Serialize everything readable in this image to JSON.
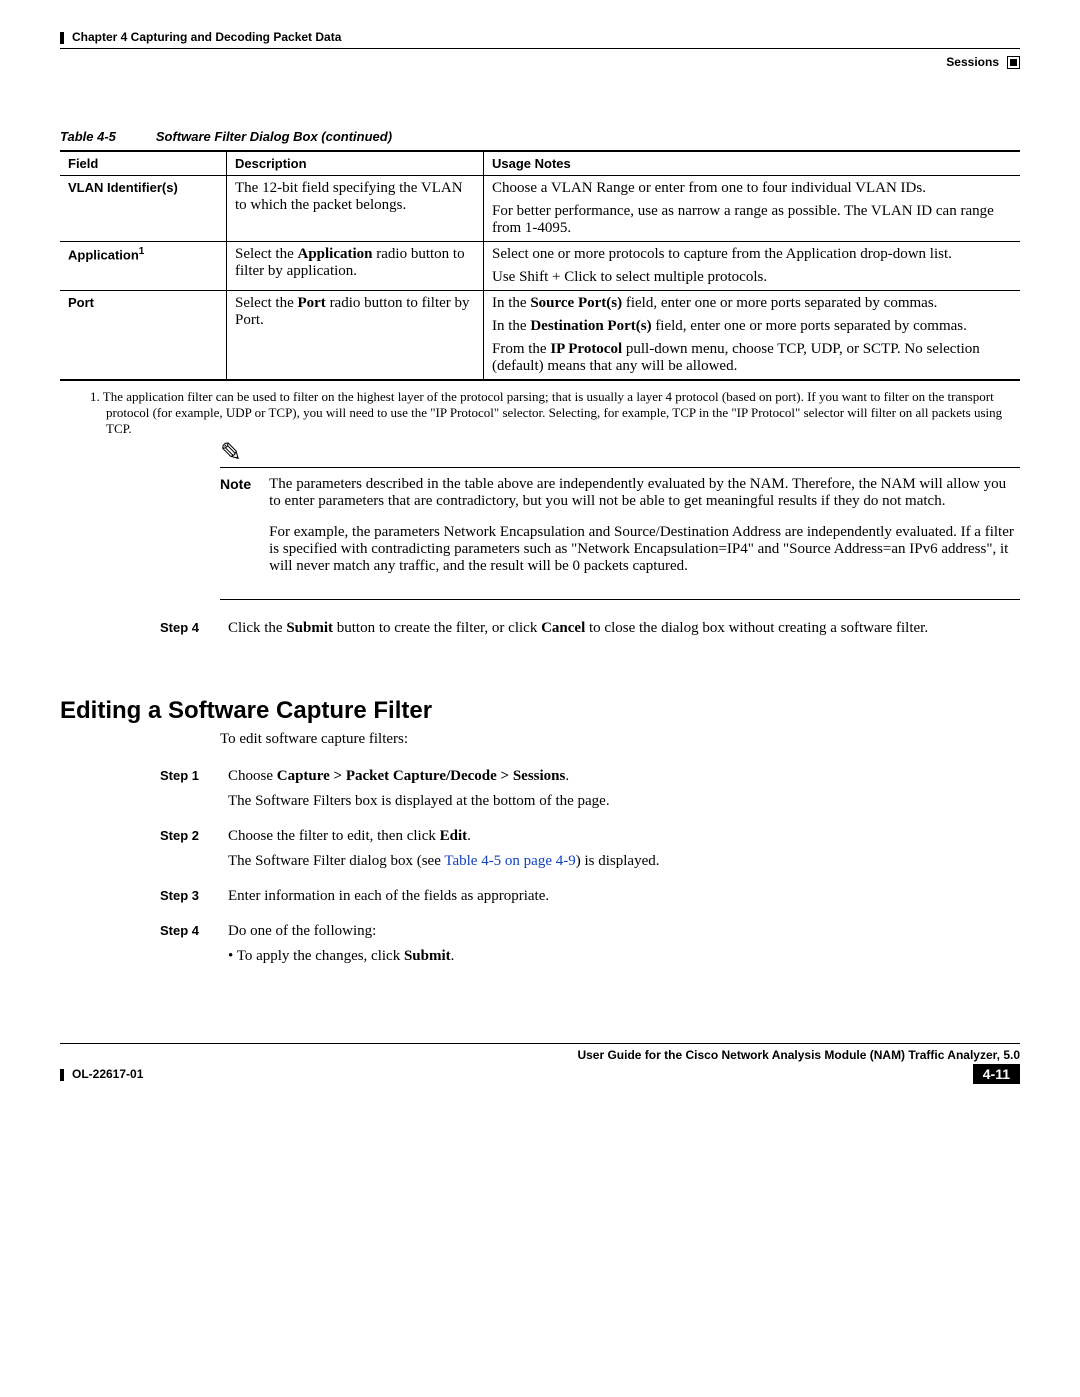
{
  "header": {
    "chapter": "Chapter 4    Capturing and Decoding Packet Data",
    "section_right": "Sessions"
  },
  "table": {
    "caption_num": "Table 4-5",
    "caption_title": "Software Filter Dialog Box (continued)",
    "columns": [
      "Field",
      "Description",
      "Usage Notes"
    ],
    "rows": [
      {
        "field": "VLAN Identifier(s)",
        "sup": "",
        "desc": "The 12-bit field specifying the VLAN to which the packet belongs.",
        "usage1": "Choose a VLAN Range or enter from one to four individual VLAN IDs.",
        "usage2": "For better performance, use as narrow a range as possible. The VLAN ID can range from 1-4095."
      },
      {
        "field": "Application",
        "sup": "1",
        "desc_pre": "Select the ",
        "desc_bold": "Application",
        "desc_post": " radio button to filter by application.",
        "usage1": "Select one or more protocols to capture from the Application drop-down list.",
        "usage2": "Use Shift + Click to select multiple protocols."
      },
      {
        "field": "Port",
        "sup": "",
        "desc_pre": "Select the ",
        "desc_bold": "Port",
        "desc_post": " radio button to filter by Port.",
        "u1_pre": "In the ",
        "u1_bold": "Source Port(s)",
        "u1_post": " field, enter one or more ports separated by commas.",
        "u2_pre": "In the ",
        "u2_bold": "Destination Port(s)",
        "u2_post": " field, enter one or more ports separated by commas.",
        "u3_pre": "From the ",
        "u3_bold": "IP Protocol",
        "u3_post": " pull-down menu, choose TCP, UDP, or SCTP. No selection (default) means that any will be allowed."
      }
    ],
    "footnote": "1. The application filter can be used to filter on the highest layer of the protocol parsing; that is usually a layer 4 protocol (based on port). If you want to filter on the transport protocol (for example, UDP or TCP), you will need to use the \"IP Protocol\" selector. Selecting, for example, TCP in the \"IP Protocol\" selector will filter on all packets using TCP."
  },
  "note": {
    "label": "Note",
    "p1": "The parameters described in the table above are independently evaluated by the NAM. Therefore, the NAM will allow you to enter parameters that are contradictory, but you will not be able to get meaningful results if they do not match.",
    "p2": "For example, the parameters Network Encapsulation and Source/Destination Address are independently evaluated. If a filter is specified with contradicting parameters such as \"Network Encapsulation=IP4\" and \"Source Address=an IPv6 address\", it will never match any traffic, and the result will be 0 packets captured."
  },
  "step_after_note": {
    "label": "Step 4",
    "t1": "Click the ",
    "b1": "Submit",
    "t2": " button to create the filter, or click ",
    "b2": "Cancel",
    "t3": " to close the dialog box without creating a software filter."
  },
  "heading2": "Editing a Software Capture Filter",
  "intro": "To edit software capture filters:",
  "steps": [
    {
      "label": "Step 1",
      "l1_pre": "Choose ",
      "l1_bold": "Capture > Packet Capture/Decode > Sessions",
      "l1_post": ".",
      "l2": "The Software Filters box is displayed at the bottom of the page."
    },
    {
      "label": "Step 2",
      "l1_pre": "Choose the filter to edit, then click ",
      "l1_bold": "Edit",
      "l1_post": ".",
      "l2_pre": "The Software Filter dialog box (see ",
      "l2_link": "Table 4-5 on page 4-9",
      "l2_post": ") is displayed."
    },
    {
      "label": "Step 3",
      "l1": "Enter information in each of the fields as appropriate."
    },
    {
      "label": "Step 4",
      "l1": "Do one of the following:",
      "bullet_pre": "To apply the changes, click ",
      "bullet_bold": "Submit",
      "bullet_post": "."
    }
  ],
  "footer": {
    "title": "User Guide for the Cisco Network Analysis Module (NAM) Traffic Analyzer, 5.0",
    "doc_id": "OL-22617-01",
    "page": "4-11"
  }
}
